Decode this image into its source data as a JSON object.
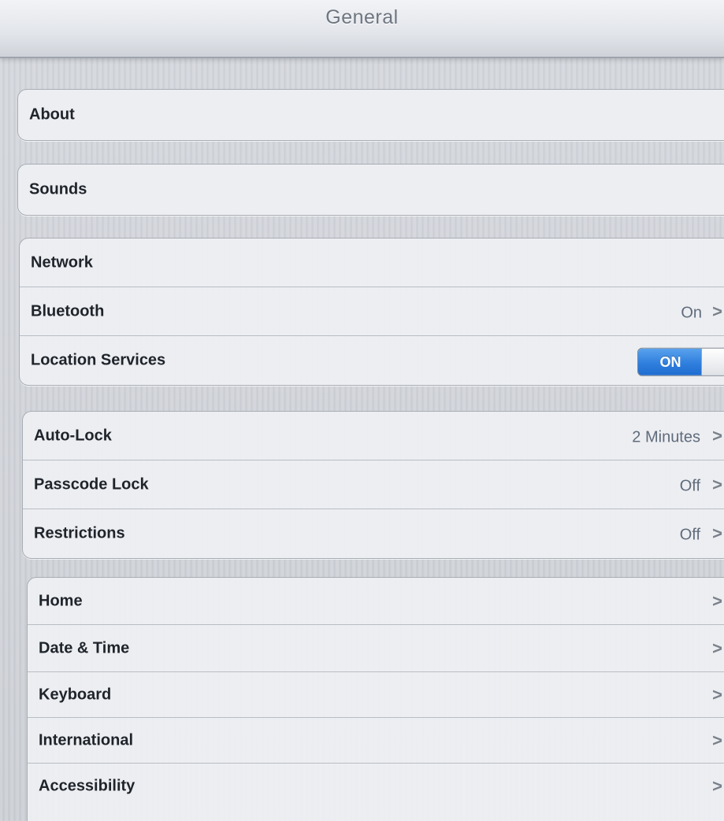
{
  "navbar": {
    "title": "General"
  },
  "groups": [
    {
      "rows": [
        {
          "label": "About",
          "value": "",
          "chevron": ">"
        }
      ]
    },
    {
      "rows": [
        {
          "label": "Sounds",
          "value": "",
          "chevron": ">"
        }
      ]
    },
    {
      "rows": [
        {
          "label": "Network",
          "value": "",
          "chevron": ">"
        },
        {
          "label": "Bluetooth",
          "value": "On",
          "chevron": ">"
        },
        {
          "label": "Location Services",
          "toggle": "ON",
          "toggle_state": true
        }
      ]
    },
    {
      "rows": [
        {
          "label": "Auto-Lock",
          "value": "2 Minutes",
          "chevron": ">"
        },
        {
          "label": "Passcode Lock",
          "value": "Off",
          "chevron": ">"
        },
        {
          "label": "Restrictions",
          "value": "Off",
          "chevron": ">"
        }
      ]
    },
    {
      "rows": [
        {
          "label": "Home",
          "value": "",
          "chevron": ">"
        },
        {
          "label": "Date & Time",
          "value": "",
          "chevron": ">"
        },
        {
          "label": "Keyboard",
          "value": "",
          "chevron": ">"
        },
        {
          "label": "International",
          "value": "",
          "chevron": ">"
        },
        {
          "label": "Accessibility",
          "value": "",
          "chevron": ">"
        }
      ]
    }
  ],
  "icons": {
    "chevron": "chevron-right-icon"
  },
  "colors": {
    "toggle_on": "#2f7fde",
    "label": "#1f242b",
    "value": "#5f6b7c"
  }
}
